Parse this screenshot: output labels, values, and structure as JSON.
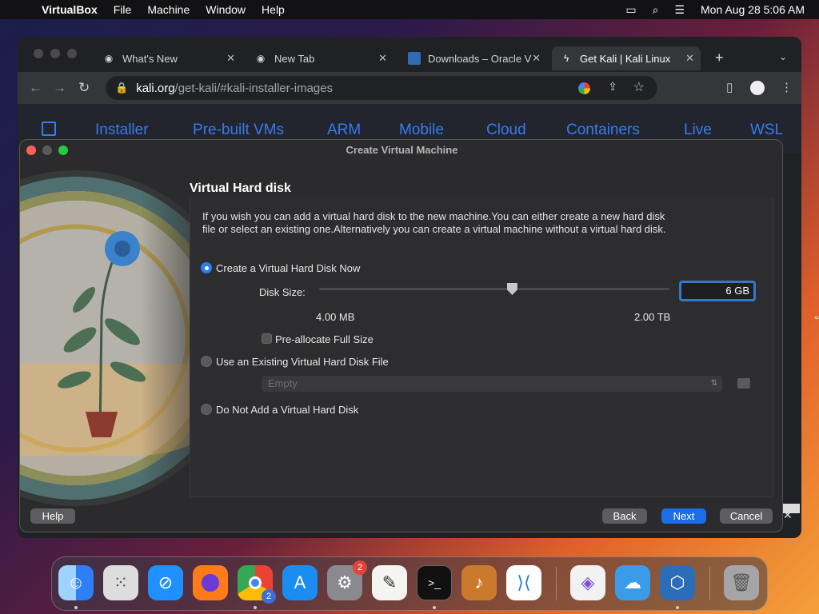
{
  "menubar": {
    "app_name": "VirtualBox",
    "items": [
      "File",
      "Machine",
      "Window",
      "Help"
    ],
    "datetime": "Mon Aug 28  5:06 AM"
  },
  "browser": {
    "tabs": [
      {
        "title": "What's New"
      },
      {
        "title": "New Tab"
      },
      {
        "title": "Downloads – Oracle V"
      },
      {
        "title": "Get Kali | Kali Linux"
      }
    ],
    "url_host": "kali.org",
    "url_path": "/get-kali/#kali-installer-images",
    "kali_nav": [
      "Installer",
      "Pre-built VMs",
      "ARM",
      "Mobile",
      "Cloud",
      "Containers",
      "Live",
      "WSL"
    ]
  },
  "dialog": {
    "title": "Create Virtual Machine",
    "heading": "Virtual Hard disk",
    "description": "If you wish you can add a virtual hard disk to the new machine.You can either create a new hard disk file or select an existing one.Alternatively you can create a virtual machine without a virtual hard disk.",
    "option_create": "Create a Virtual Hard Disk Now",
    "disk_size_label": "Disk Size:",
    "disk_size_value": "6 GB",
    "slider_min": "4.00 MB",
    "slider_max": "2.00 TB",
    "slider_fraction": 0.55,
    "preallocate_label": "Pre-allocate Full Size",
    "option_existing": "Use an Existing Virtual Hard Disk File",
    "existing_placeholder": "Empty",
    "option_none": "Do Not Add a Virtual Hard Disk",
    "help_btn": "Help",
    "back_btn": "Back",
    "next_btn": "Next",
    "cancel_btn": "Cancel"
  },
  "dock": {
    "settings_badge": "2",
    "chrome_badge": "2"
  }
}
